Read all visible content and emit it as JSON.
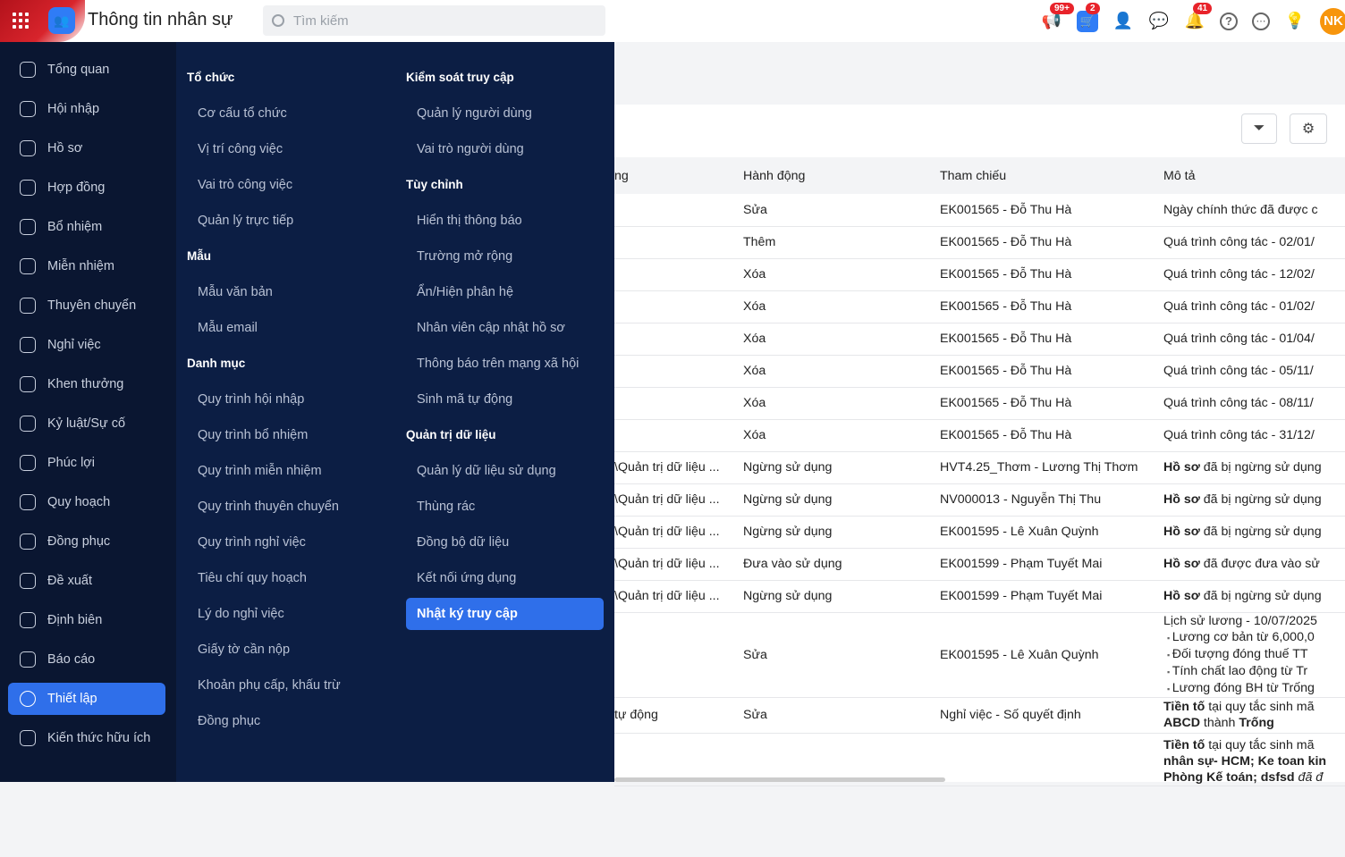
{
  "header": {
    "title": "Thông tin nhân sự",
    "search_placeholder": "Tìm kiếm",
    "badges": {
      "announcements": "99+",
      "cart": "2",
      "notifications": "41"
    },
    "avatar": "NK"
  },
  "sidebar": {
    "items": [
      {
        "label": "Tổng quan"
      },
      {
        "label": "Hội nhập"
      },
      {
        "label": "Hồ sơ"
      },
      {
        "label": "Hợp đồng"
      },
      {
        "label": "Bổ nhiệm"
      },
      {
        "label": "Miễn nhiệm"
      },
      {
        "label": "Thuyên chuyển"
      },
      {
        "label": "Nghỉ việc"
      },
      {
        "label": "Khen thưởng"
      },
      {
        "label": "Kỷ luật/Sự cố"
      },
      {
        "label": "Phúc lợi"
      },
      {
        "label": "Quy hoạch"
      },
      {
        "label": "Đồng phục"
      },
      {
        "label": "Đề xuất"
      },
      {
        "label": "Định biên"
      },
      {
        "label": "Báo cáo"
      },
      {
        "label": "Thiết lập"
      },
      {
        "label": "Kiến thức hữu ích"
      }
    ]
  },
  "menu": {
    "col1": [
      {
        "heading": "Tổ chức",
        "items": [
          "Cơ cấu tổ chức",
          "Vị trí công việc",
          "Vai trò công việc",
          "Quản lý trực tiếp"
        ]
      },
      {
        "heading": "Mẫu",
        "items": [
          "Mẫu văn bản",
          "Mẫu email"
        ]
      },
      {
        "heading": "Danh mục",
        "items": [
          "Quy trình hội nhập",
          "Quy trình bổ nhiệm",
          "Quy trình miễn nhiệm",
          "Quy trình thuyên chuyển",
          "Quy trình nghỉ việc",
          "Tiêu chí quy hoạch",
          "Lý do nghỉ việc",
          "Giấy tờ cần nộp",
          "Khoản phụ cấp, khấu trừ",
          "Đồng phục"
        ]
      }
    ],
    "col2": [
      {
        "heading": "Kiểm soát truy cập",
        "items": [
          "Quản lý người dùng",
          "Vai trò người dùng"
        ]
      },
      {
        "heading": "Tùy chỉnh",
        "items": [
          "Hiển thị thông báo",
          "Trường mở rộng",
          "Ẩn/Hiện phân hệ",
          "Nhân viên cập nhật hồ sơ",
          "Thông báo trên mạng xã hội",
          "Sinh mã tự động"
        ]
      },
      {
        "heading": "Quản trị dữ liệu",
        "items": [
          "Quản lý dữ liệu sử dụng",
          "Thùng rác",
          "Đồng bộ dữ liệu",
          "Kết nối ứng dụng",
          "Nhật ký truy cập"
        ]
      }
    ]
  },
  "table": {
    "headers": [
      "ng",
      "Hành động",
      "Tham chiếu",
      "Mô tả"
    ],
    "rows": [
      [
        "",
        "Sửa",
        "EK001565 - Đỗ Thu Hà",
        "Ngày chính thức đã được c"
      ],
      [
        "",
        "Thêm",
        "EK001565 - Đỗ Thu Hà",
        "Quá trình công tác - 02/01/"
      ],
      [
        "",
        "Xóa",
        "EK001565 - Đỗ Thu Hà",
        "Quá trình công tác - 12/02/"
      ],
      [
        "",
        "Xóa",
        "EK001565 - Đỗ Thu Hà",
        "Quá trình công tác - 01/02/"
      ],
      [
        "",
        "Xóa",
        "EK001565 - Đỗ Thu Hà",
        "Quá trình công tác - 01/04/"
      ],
      [
        "",
        "Xóa",
        "EK001565 - Đỗ Thu Hà",
        "Quá trình công tác - 05/11/"
      ],
      [
        "",
        "Xóa",
        "EK001565 - Đỗ Thu Hà",
        "Quá trình công tác - 08/11/"
      ],
      [
        "",
        "Xóa",
        "EK001565 - Đỗ Thu Hà",
        "Quá trình công tác - 31/12/"
      ],
      [
        "\\Quản trị dữ liệu ...",
        "Ngừng sử dụng",
        "HVT4.25_Thơm - Lương Thị Thơm",
        "Hồ sơ|đã bị ngừng sử dụng"
      ],
      [
        "\\Quản trị dữ liệu ...",
        "Ngừng sử dụng",
        "NV000013 - Nguyễn Thị Thu",
        "Hồ sơ|đã bị ngừng sử dụng"
      ],
      [
        "\\Quản trị dữ liệu ...",
        "Ngừng sử dụng",
        "EK001595 - Lê Xuân Quỳnh",
        "Hồ sơ|đã bị ngừng sử dụng"
      ],
      [
        "\\Quản trị dữ liệu ...",
        "Đưa vào sử dụng",
        "EK001599 - Phạm Tuyết Mai",
        "Hồ sơ|đã được đưa vào sử"
      ],
      [
        "\\Quản trị dữ liệu ...",
        "Ngừng sử dụng",
        "EK001599 - Phạm Tuyết Mai",
        "Hồ sơ|đã bị ngừng sử dụng"
      ]
    ],
    "salary_row": {
      "action": "Sửa",
      "ref": "EK001595 - Lê Xuân Quỳnh",
      "title": "Lịch sử lương - 10/07/2025",
      "bullets": [
        "Lương cơ bản từ 6,000,0",
        "Đối tượng đóng thuế TT",
        "Tính chất lao động từ Tr",
        "Lương đóng BH từ Trống"
      ]
    },
    "prefix_row": {
      "module": "tự động",
      "action": "Sửa",
      "ref": "Nghỉ việc - Số quyết định",
      "b1": "Tiền tố",
      "t1": " tại quy tắc sinh mã",
      "b2": "ABCD",
      "t2": " thành ",
      "b3": "Trống"
    },
    "last_row": {
      "b1": "Tiền tố",
      "t1": " tại quy tắc sinh mã",
      "b2": "nhân sự- HCM; Ke toan kin",
      "b3": "Phòng Kế toán; dsfsd",
      "t3": " đã đ"
    }
  }
}
